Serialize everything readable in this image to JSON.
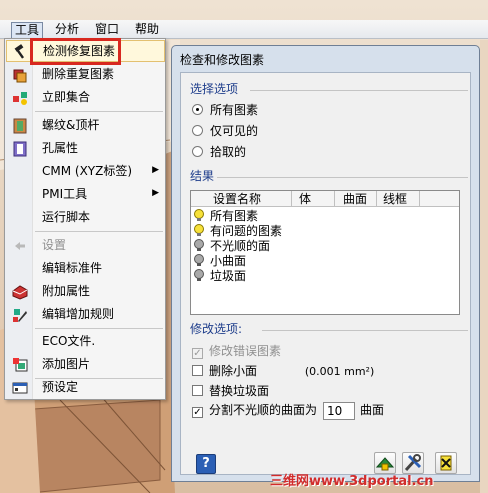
{
  "menubar": {
    "items": [
      "工具",
      "分析",
      "窗口",
      "帮助"
    ]
  },
  "tools_menu": {
    "items": [
      {
        "label": "检测修复图素",
        "icon": "hammer-icon"
      },
      {
        "label": "删除重复图素",
        "icon": "duplicate-delete-icon"
      },
      {
        "label": "立即集合",
        "icon": "assemble-icon"
      },
      {
        "label": "螺纹&顶杆",
        "icon": "thread-pin-icon"
      },
      {
        "label": "孔属性",
        "icon": "hole-attr-icon"
      },
      {
        "label": "CMM (XYZ标签)",
        "icon": "",
        "submenu": true
      },
      {
        "label": "PMI工具",
        "icon": "",
        "submenu": true
      },
      {
        "label": "运行脚本",
        "icon": ""
      },
      {
        "label": "设置",
        "icon": "settings-arrow-icon",
        "disabled": true
      },
      {
        "label": "编辑标准件",
        "icon": ""
      },
      {
        "label": "附加属性",
        "icon": "attribute-icon"
      },
      {
        "label": "编辑增加规则",
        "icon": "edit-rule-icon"
      },
      {
        "label": "ECO文件.",
        "icon": ""
      },
      {
        "label": "添加图片",
        "icon": "add-image-icon"
      },
      {
        "label": "预设定",
        "icon": "preset-icon"
      }
    ]
  },
  "dialog": {
    "title": "检查和修改图素",
    "select_section": "选择选项",
    "select_options": [
      "所有图素",
      "仅可见的",
      "拾取的"
    ],
    "select_selected": 0,
    "results_section": "结果",
    "results_columns": [
      "设置名称",
      "体",
      "曲面",
      "线框"
    ],
    "results_rows": [
      {
        "name": "所有图素",
        "bulb": "yellow"
      },
      {
        "name": "有问题的图素",
        "bulb": "yellow"
      },
      {
        "name": "不光顺的面",
        "bulb": "gray"
      },
      {
        "name": "小曲面",
        "bulb": "gray"
      },
      {
        "name": "垃圾面",
        "bulb": "gray"
      }
    ],
    "modify_section": "修改选项:",
    "modify_options": {
      "fix_errors": {
        "label": "修改错误图素",
        "checked": true,
        "disabled": true
      },
      "delete_small": {
        "label": "删除小面",
        "checked": false,
        "extra": "(0.001 mm²)"
      },
      "replace_junk": {
        "label": "替换垃圾面",
        "checked": false
      },
      "split_rough": {
        "label": "分割不光顺的曲面为",
        "checked": true,
        "value": "10",
        "unit": "曲面"
      }
    },
    "help_label": "?"
  },
  "watermark": "三维网www.3dportal.cn",
  "colors": {
    "highlight_box": "#d8281f",
    "section_text": "#1f3e8c",
    "dialog_frame": "#d6e0ec"
  }
}
